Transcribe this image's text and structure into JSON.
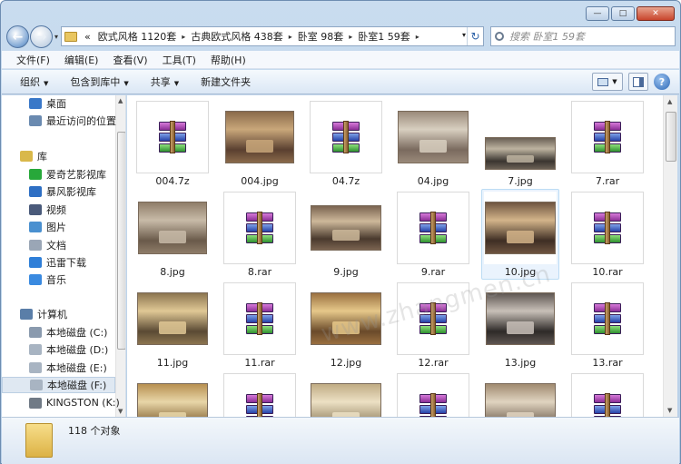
{
  "window": {
    "controls": {
      "minimize": "—",
      "maximize": "□",
      "close": "✕"
    }
  },
  "nav": {
    "back_icon": "←",
    "forward_icon": "→",
    "dropdown_icon": "▾"
  },
  "address": {
    "prefix": "«",
    "crumbs": [
      "欧式风格 1120套",
      "古典欧式风格 438套",
      "卧室 98套",
      "卧室1 59套"
    ],
    "separator": "▸",
    "refresh_icon": "↻"
  },
  "search": {
    "placeholder": "搜索 卧室1 59套"
  },
  "menu": [
    "文件(F)",
    "编辑(E)",
    "查看(V)",
    "工具(T)",
    "帮助(H)"
  ],
  "toolbar": {
    "organize": "组织",
    "include_in_library": "包含到库中",
    "share": "共享",
    "new_folder": "新建文件夹",
    "help_icon": "?"
  },
  "sidebar": {
    "favorites": [
      {
        "label": "桌面",
        "icon": "desktop-icon"
      },
      {
        "label": "最近访问的位置",
        "icon": "recent-places-icon"
      }
    ],
    "libraries_header": "库",
    "libraries": [
      {
        "label": "爱奇艺影视库",
        "icon": "iqiyi-icon"
      },
      {
        "label": "暴风影视库",
        "icon": "baofeng-icon"
      },
      {
        "label": "视频",
        "icon": "video-icon"
      },
      {
        "label": "图片",
        "icon": "pictures-icon"
      },
      {
        "label": "文档",
        "icon": "documents-icon"
      },
      {
        "label": "迅雷下载",
        "icon": "thunder-icon"
      },
      {
        "label": "音乐",
        "icon": "music-icon"
      }
    ],
    "computer_header": "计算机",
    "drives": [
      {
        "label": "本地磁盘 (C:)",
        "icon": "drive-c-icon"
      },
      {
        "label": "本地磁盘 (D:)",
        "icon": "drive-icon"
      },
      {
        "label": "本地磁盘 (E:)",
        "icon": "drive-icon"
      },
      {
        "label": "本地磁盘 (F:)",
        "icon": "drive-icon",
        "selected": true
      },
      {
        "label": "KINGSTON (K:)",
        "icon": "usb-drive-icon"
      }
    ]
  },
  "files": [
    {
      "name": "004.7z",
      "kind": "archive"
    },
    {
      "name": "004.jpg",
      "kind": "image",
      "palette": [
        "#5a4030",
        "#c9a77a",
        "#8a6a4a"
      ]
    },
    {
      "name": "04.7z",
      "kind": "archive"
    },
    {
      "name": "04.jpg",
      "kind": "image",
      "palette": [
        "#7a6a5e",
        "#d8cfc0",
        "#9a8a7a"
      ]
    },
    {
      "name": "7.jpg",
      "kind": "image",
      "palette": [
        "#3a3530",
        "#bdb3a0",
        "#6a6055"
      ]
    },
    {
      "name": "7.rar",
      "kind": "archive"
    },
    {
      "name": "8.jpg",
      "kind": "image",
      "palette": [
        "#6a5a4a",
        "#c8bba8",
        "#8f7d69"
      ]
    },
    {
      "name": "8.rar",
      "kind": "archive"
    },
    {
      "name": "9.jpg",
      "kind": "image",
      "palette": [
        "#4a3a2e",
        "#cdb89a",
        "#7a6350"
      ]
    },
    {
      "name": "9.rar",
      "kind": "archive"
    },
    {
      "name": "10.jpg",
      "kind": "image",
      "palette": [
        "#3e2e24",
        "#d3b48a",
        "#6e5440"
      ],
      "selected": true
    },
    {
      "name": "10.rar",
      "kind": "archive"
    },
    {
      "name": "11.jpg",
      "kind": "image",
      "palette": [
        "#5a4a34",
        "#e0c895",
        "#8c7550"
      ]
    },
    {
      "name": "11.rar",
      "kind": "archive"
    },
    {
      "name": "12.jpg",
      "kind": "image",
      "palette": [
        "#6a4a2a",
        "#e6c88a",
        "#9a7040"
      ]
    },
    {
      "name": "12.rar",
      "kind": "archive"
    },
    {
      "name": "13.jpg",
      "kind": "image",
      "palette": [
        "#2e2a28",
        "#c8c0b8",
        "#5e5652"
      ]
    },
    {
      "name": "13.rar",
      "kind": "archive"
    },
    {
      "name": "",
      "kind": "image",
      "palette": [
        "#8a6a3a",
        "#e8d6a8",
        "#b89050"
      ]
    },
    {
      "name": "",
      "kind": "archive"
    },
    {
      "name": "",
      "kind": "image",
      "palette": [
        "#9a8a6a",
        "#ece0c4",
        "#c0ac84"
      ]
    },
    {
      "name": "",
      "kind": "archive"
    },
    {
      "name": "",
      "kind": "image",
      "palette": [
        "#7a6a5a",
        "#e0d4c0",
        "#a08a70"
      ]
    },
    {
      "name": "",
      "kind": "archive"
    }
  ],
  "status": {
    "count": "118 个对象"
  }
}
